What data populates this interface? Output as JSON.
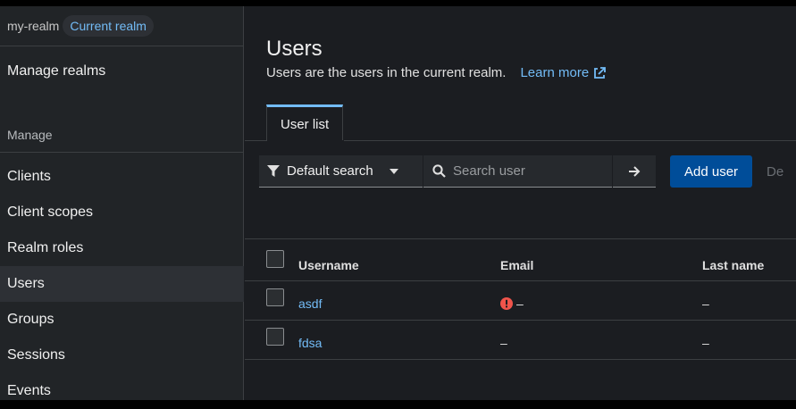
{
  "sidebar": {
    "realm_name": "my-realm",
    "realm_badge": "Current realm",
    "manage_realms": "Manage realms",
    "section_label": "Manage",
    "items": [
      {
        "label": "Clients"
      },
      {
        "label": "Client scopes"
      },
      {
        "label": "Realm roles"
      },
      {
        "label": "Users"
      },
      {
        "label": "Groups"
      },
      {
        "label": "Sessions"
      },
      {
        "label": "Events"
      }
    ],
    "active_item": "Users"
  },
  "page": {
    "title": "Users",
    "description": "Users are the users in the current realm.",
    "learn_more": "Learn more"
  },
  "tabs": [
    {
      "label": "User list"
    }
  ],
  "toolbar": {
    "filter_label": "Default search",
    "search_placeholder": "Search user",
    "add_user_label": "Add user",
    "more_label": "De"
  },
  "table": {
    "headers": [
      "Username",
      "Email",
      "Last name"
    ],
    "rows": [
      {
        "username": "asdf",
        "email": "–",
        "email_unverified": true,
        "last_name": "–"
      },
      {
        "username": "fdsa",
        "email": "–",
        "email_unverified": false,
        "last_name": "–"
      }
    ]
  },
  "colors": {
    "accent": "#73bcf7",
    "primary_button": "#004d99",
    "error": "#f0544b"
  }
}
